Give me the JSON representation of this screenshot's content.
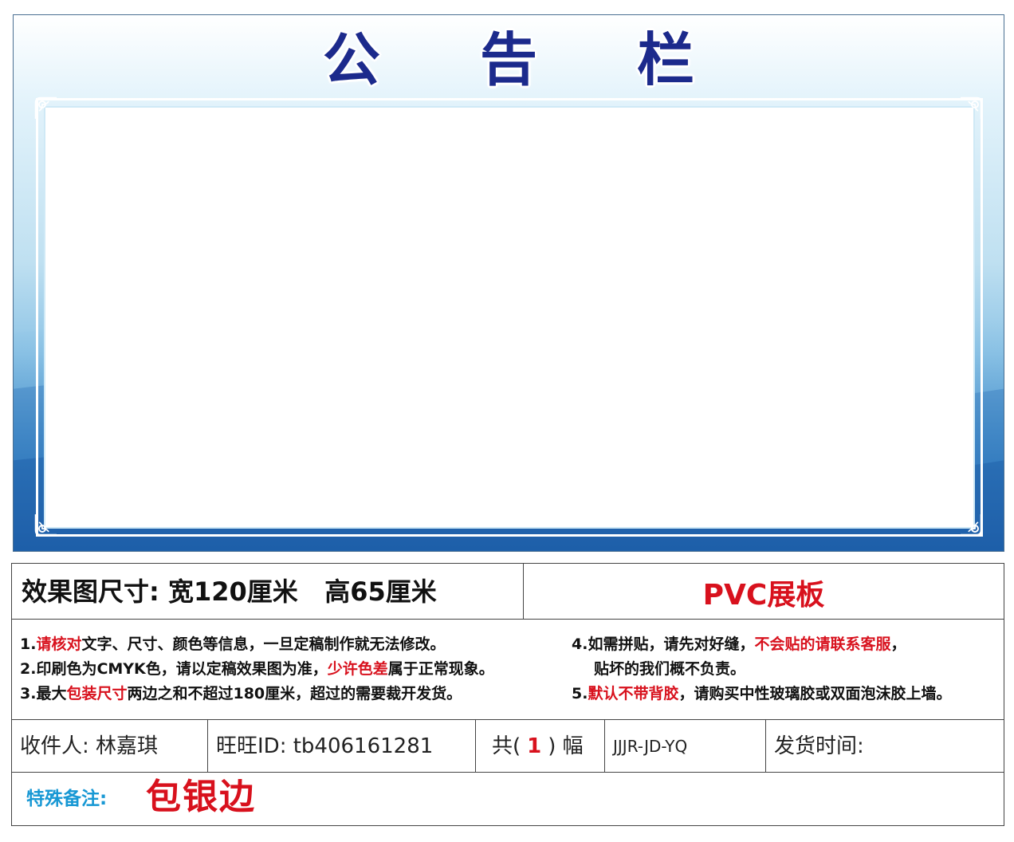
{
  "board": {
    "title": "公 告 栏",
    "colors": {
      "title": "#1c2a8c",
      "frame": "#ffffff",
      "bottom": "#1e63ac"
    }
  },
  "spec": {
    "size_label": "效果图尺寸:",
    "width_text": "宽120厘米",
    "height_text": "高65厘米",
    "material": "PVC展板"
  },
  "notes": {
    "left": [
      {
        "parts": [
          "1.",
          "请核对",
          "文字、尺寸、颜色等信息，一旦定稿制作就无法修改。"
        ]
      },
      {
        "parts": [
          "2.印刷色为CMYK色，请以定稿效果图为准，",
          "少许色差",
          "属于正常现象。"
        ]
      },
      {
        "parts": [
          "3.最大",
          "包装尺寸",
          "两边之和不超过180厘米，超过的需要裁开发货。"
        ]
      }
    ],
    "right": [
      {
        "parts": [
          "4.如需拼贴，请先对好缝，",
          "不会贴的请联系客服",
          "，"
        ]
      },
      {
        "parts": [
          "贴坏的我们概不负责。"
        ]
      },
      {
        "parts": [
          "5.",
          "默认不带背胶",
          "，请购买中性玻璃胶或双面泡沫胶上墙。"
        ]
      }
    ]
  },
  "order": {
    "recipient": "收件人: 林嘉琪",
    "wangwang": "旺旺ID: tb406161281",
    "qty_prefix": "共(",
    "qty": "1",
    "qty_suffix": ") 幅",
    "code": "JJJR-JD-YQ",
    "ship_time": "发货时间:"
  },
  "remark": {
    "label": "特殊备注:",
    "value": "包银边"
  }
}
